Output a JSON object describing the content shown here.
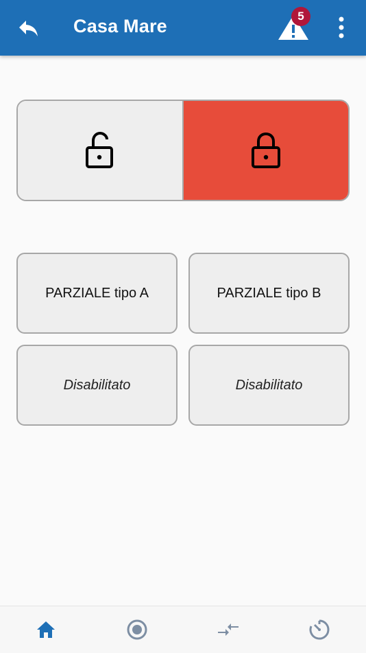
{
  "header": {
    "title": "Casa Mare",
    "alert_count": "5",
    "back_icon": "reply-arrow-icon",
    "alert_icon": "warning-triangle-icon",
    "menu_icon": "more-vertical-icon",
    "color": "#1e6fb6"
  },
  "arm_toggle": {
    "disarm_icon": "lock-open-icon",
    "arm_icon": "lock-closed-icon",
    "active_color": "#e74c3a",
    "selected": "arm"
  },
  "partial_buttons": [
    {
      "label": "PARZIALE tipo A"
    },
    {
      "label": "PARZIALE tipo B"
    },
    {
      "label": "Disabilitato"
    },
    {
      "label": "Disabilitato"
    }
  ],
  "bottom_nav": {
    "items": [
      "home-icon",
      "record-icon",
      "compress-arrows-icon",
      "timer-icon"
    ],
    "active": "home-icon",
    "active_color": "#1e6fb6",
    "inactive_color": "#7d8ea3"
  }
}
